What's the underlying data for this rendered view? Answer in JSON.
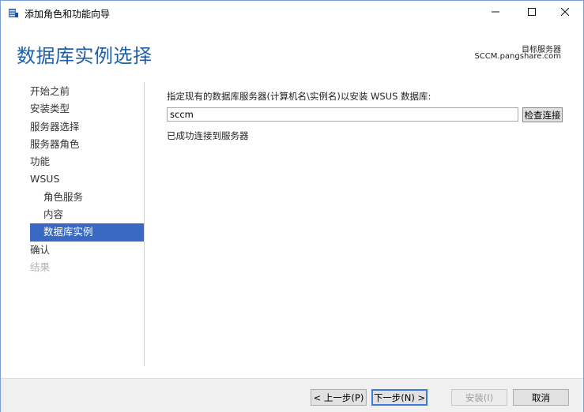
{
  "window": {
    "title": "添加角色和功能向导",
    "controls": {
      "minimize_icon": "minimize-icon",
      "maximize_icon": "maximize-icon",
      "close_icon": "close-icon"
    }
  },
  "header": {
    "page_title": "数据库实例选择",
    "target_server_label": "目标服务器",
    "target_server_name": "SCCM.pangshare.com"
  },
  "nav": {
    "items": [
      {
        "label": "开始之前",
        "state": "normal",
        "level": 0
      },
      {
        "label": "安装类型",
        "state": "normal",
        "level": 0
      },
      {
        "label": "服务器选择",
        "state": "normal",
        "level": 0
      },
      {
        "label": "服务器角色",
        "state": "normal",
        "level": 0
      },
      {
        "label": "功能",
        "state": "normal",
        "level": 0
      },
      {
        "label": "WSUS",
        "state": "normal",
        "level": 0
      },
      {
        "label": "角色服务",
        "state": "normal",
        "level": 1
      },
      {
        "label": "内容",
        "state": "normal",
        "level": 1
      },
      {
        "label": "数据库实例",
        "state": "active",
        "level": 1
      },
      {
        "label": "确认",
        "state": "normal",
        "level": 0
      },
      {
        "label": "结果",
        "state": "disabled",
        "level": 0
      }
    ]
  },
  "content": {
    "instruction": "指定现有的数据库服务器(计算机名\\实例名)以安装 WSUS 数据库:",
    "db_input_value": "sccm",
    "check_button": "检查连接",
    "status": "已成功连接到服务器"
  },
  "footer": {
    "prev": "< 上一步(P)",
    "next": "下一步(N) >",
    "install": "安装(I)",
    "cancel": "取消"
  },
  "colors": {
    "accent": "#3869c3",
    "title_blue": "#1e5fa8"
  }
}
